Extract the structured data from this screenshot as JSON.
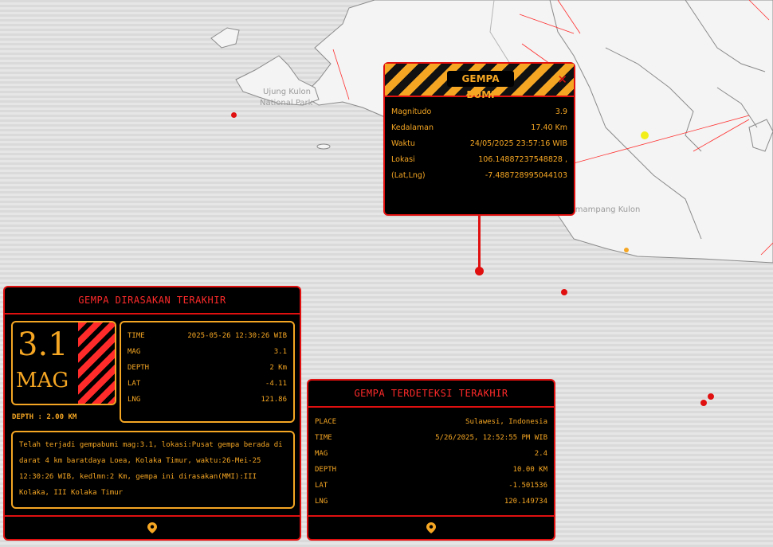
{
  "map": {
    "labels": [
      "Ujung Kulon",
      "National Park",
      "Cimampang Kulon"
    ]
  },
  "popup": {
    "title": "GEMPA BUMI",
    "close_glyph": "✕",
    "rows": [
      {
        "label": "Magnitudo",
        "value": "3.9"
      },
      {
        "label": "Kedalaman",
        "value": "17.40 Km"
      },
      {
        "label": "Waktu",
        "value": "24/05/2025 23:57:16 WIB"
      },
      {
        "label": "Lokasi",
        "value": "106.14887237548828 ,"
      },
      {
        "label": "(Lat,Lng)",
        "value": "-7.488728995044103"
      }
    ]
  },
  "felt": {
    "title": "GEMPA DIRASAKAN TERAKHIR",
    "mag_value": "3.1",
    "mag_unit": "MAG",
    "depth_text": "DEPTH : 2.00 KM",
    "rows": [
      {
        "label": "TIME",
        "value": "2025-05-26 12:30:26 WIB"
      },
      {
        "label": "MAG",
        "value": "3.1"
      },
      {
        "label": "DEPTH",
        "value": "2 Km"
      },
      {
        "label": "LAT",
        "value": "-4.11"
      },
      {
        "label": "LNG",
        "value": "121.86"
      }
    ],
    "description": "Telah terjadi gempabumi mag:3.1, lokasi:Pusat gempa berada di darat 4 km baratdaya Loea, Kolaka Timur, waktu:26-Mei-25 12:30:26 WIB, kedlmn:2 Km, gempa ini dirasakan(MMI):III Kolaka, III Kolaka Timur",
    "footer_icon": "map-pin-icon"
  },
  "detected": {
    "title": "GEMPA TERDETEKSI TERAKHIR",
    "rows": [
      {
        "label": "PLACE",
        "value": "Sulawesi, Indonesia"
      },
      {
        "label": "TIME",
        "value": "5/26/2025, 12:52:55 PM WIB"
      },
      {
        "label": "MAG",
        "value": "2.4"
      },
      {
        "label": "DEPTH",
        "value": "10.00 KM"
      },
      {
        "label": "LAT",
        "value": "-1.501536"
      },
      {
        "label": "LNG",
        "value": "120.149734"
      }
    ],
    "footer_icon": "map-pin-icon"
  },
  "colors": {
    "accent": "#f5a623",
    "alert": "#e01010",
    "panel_bg": "#000000",
    "quake_dot": "#e01010",
    "quake_dot_yellow": "#f2ee1a",
    "quake_dot_orange": "#f5a623"
  }
}
